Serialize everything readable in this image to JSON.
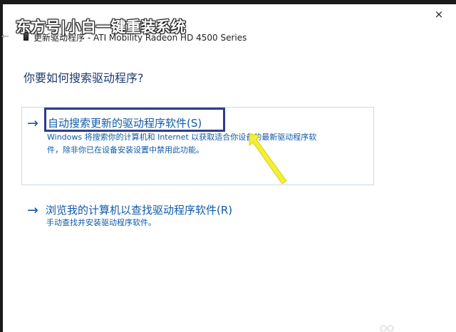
{
  "watermark": {
    "text": "东方号|小白一键重装系统"
  },
  "window": {
    "title": "更新驱动程序 - ATI Mobility Radeon HD 4500 Series",
    "back_icon": "back-arrow-icon",
    "close_icon": "close-icon",
    "close_glyph": "×",
    "back_glyph": "←"
  },
  "heading": "你要如何搜索驱动程序?",
  "options": [
    {
      "arrow": "→",
      "title": "自动搜索更新的驱动程序软件(S)",
      "desc_line1": "Windows 将搜索你的计算机和 Internet 以获取适合你设备的最新驱动程序软",
      "desc_line2": "件，除非你已在设备安装设置中禁用此功能。"
    },
    {
      "arrow": "→",
      "title": "浏览我的计算机以查找驱动程序软件(R)",
      "desc_line1": "手动查找并安装驱动程序软件。"
    }
  ],
  "colors": {
    "link_blue": "#0f5aa8",
    "heading_blue": "#1e3a6e",
    "highlight_outline": "#2c3d8a",
    "annotation_yellow": "#f2ee3a"
  }
}
